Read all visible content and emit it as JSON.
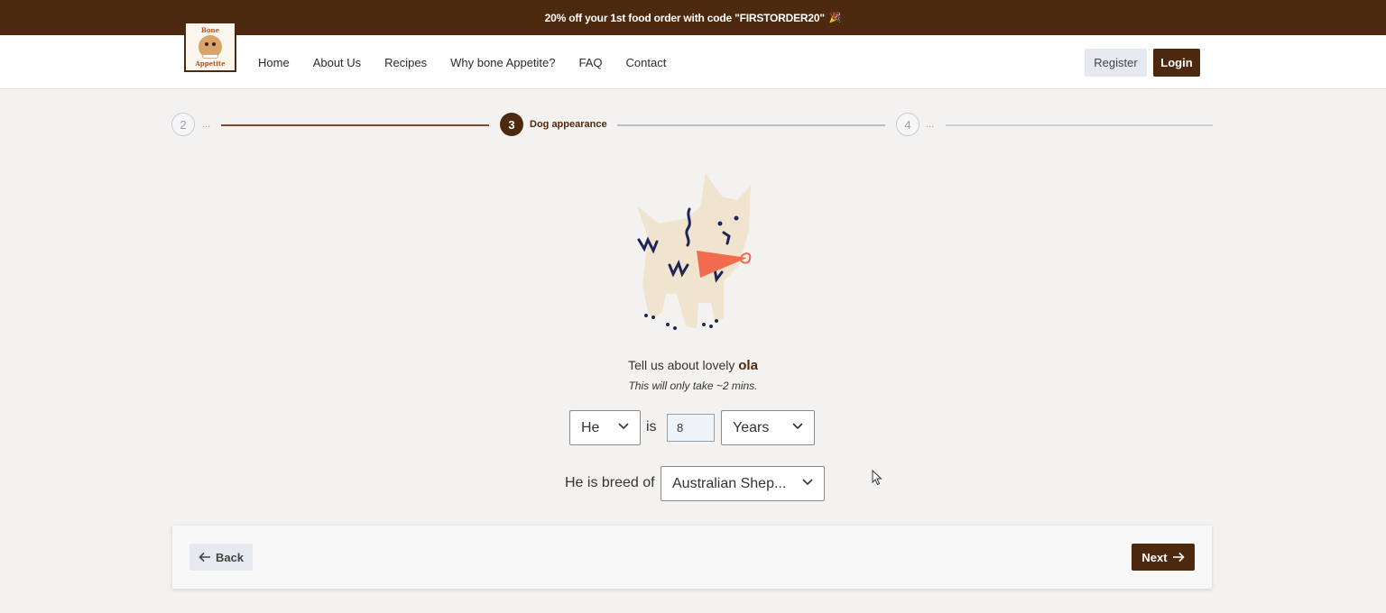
{
  "promo": {
    "text": "20% off your 1st food order with code \"FIRSTORDER20\"",
    "icon": "party-popper-icon"
  },
  "header": {
    "logo_text_top": "Bone",
    "logo_text_bottom": "Appetite",
    "nav": [
      "Home",
      "About Us",
      "Recipes",
      "Why bone Appetite?",
      "FAQ",
      "Contact"
    ],
    "register_label": "Register",
    "login_label": "Login"
  },
  "stepper": {
    "prev": {
      "number": "2",
      "label": "..."
    },
    "current": {
      "number": "3",
      "label": "Dog appearance"
    },
    "next": {
      "number": "4",
      "label": "..."
    }
  },
  "form": {
    "intro_prefix": "Tell us about lovely ",
    "dog_name": "ola",
    "subnote": "This will only take ~2 mins.",
    "pronoun_value": "He",
    "is_text": "is",
    "age_value": "8",
    "age_unit_value": "Years",
    "breed_label": "He is breed of",
    "breed_value": "Australian Shep..."
  },
  "footer": {
    "back_label": "Back",
    "next_label": "Next"
  },
  "colors": {
    "brand": "#4d2a0f",
    "accent_bandana": "#f26b4f",
    "secondary_button": "#e6e9ef"
  }
}
